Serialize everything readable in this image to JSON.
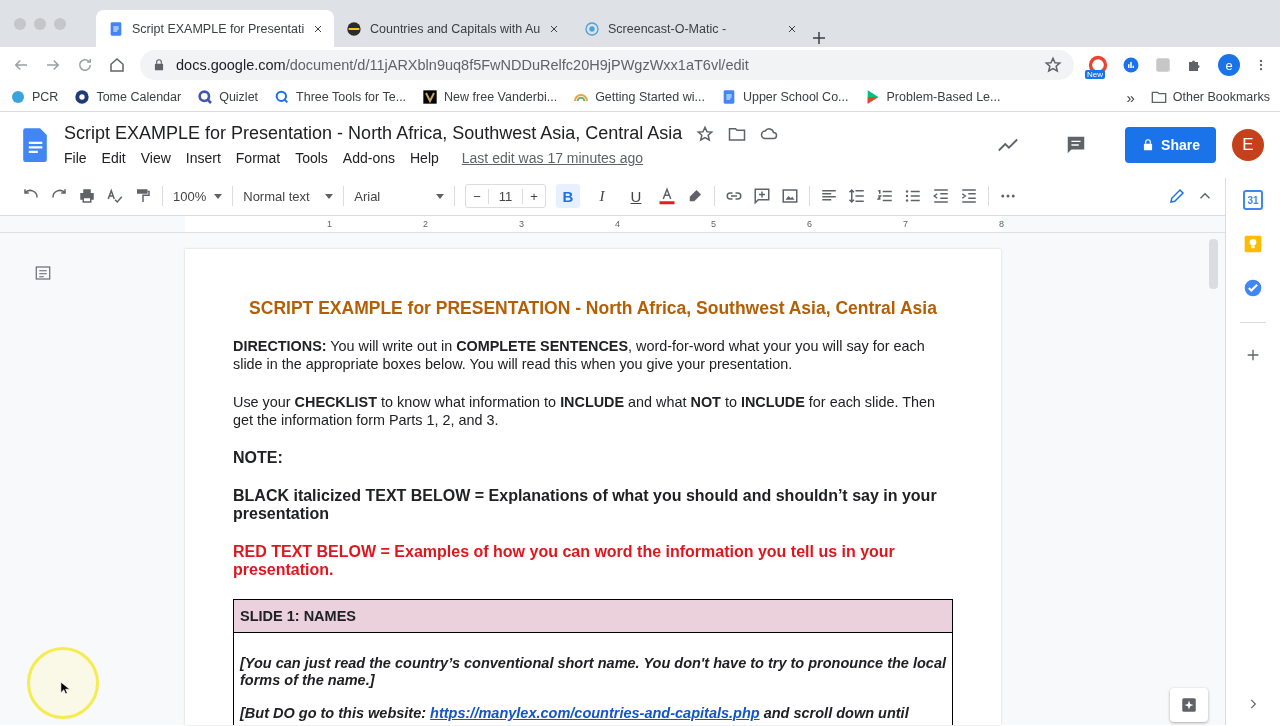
{
  "browser": {
    "tabs": [
      {
        "title": "Script EXAMPLE for Presentati",
        "selected": true,
        "kind": "docs"
      },
      {
        "title": "Countries and Capitals with Au",
        "selected": false,
        "kind": "globe"
      },
      {
        "title": "Screencast-O-Matic -",
        "selected": false,
        "kind": "record"
      }
    ],
    "url": {
      "domain": "docs.google.com",
      "path": "/document/d/11jARXbln9uq8f5FwNDDuRelfc20H9jPWgzWxx1aT6vl/edit"
    },
    "extension_badge": "New",
    "profile": "e",
    "bookmarks": [
      {
        "label": "PCR",
        "kind": "pcr"
      },
      {
        "label": "Tome Calendar",
        "kind": "st"
      },
      {
        "label": "Quizlet",
        "kind": "q"
      },
      {
        "label": "Three Tools for Te...",
        "kind": "search"
      },
      {
        "label": "New free Vanderbi...",
        "kind": "v"
      },
      {
        "label": "Getting Started wi...",
        "kind": "rainbow"
      },
      {
        "label": "Upper School Co...",
        "kind": "docs"
      },
      {
        "label": "Problem-Based Le...",
        "kind": "play"
      }
    ],
    "bookmarks_overflow": "»",
    "other_bookmarks": "Other Bookmarks"
  },
  "docs": {
    "title": "Script EXAMPLE for Presentation - North Africa, Southwest Asia, Central Asia",
    "menu": [
      "File",
      "Edit",
      "View",
      "Insert",
      "Format",
      "Tools",
      "Add-ons",
      "Help"
    ],
    "last_edit": "Last edit was 17 minutes ago",
    "share": "Share",
    "avatar": "E"
  },
  "toolbar": {
    "zoom": "100%",
    "style": "Normal text",
    "font": "Arial",
    "minus": "−",
    "size": "11",
    "plus": "+",
    "bold_label": "B",
    "italic_label": "I",
    "underline_label": "U",
    "bold": true,
    "italic": false,
    "underline": false
  },
  "ruler": [
    "1",
    "2",
    "3",
    "4",
    "5",
    "6",
    "7",
    "8"
  ],
  "side_panel": {
    "calendar_day": "31"
  },
  "document": {
    "heading": "SCRIPT EXAMPLE for PRESENTATION - North Africa, Southwest Asia, Central Asia",
    "paragraphs": [
      {
        "kind": "normal",
        "text": "**DIRECTIONS:** You will write out in **COMPLETE SENTENCES**, word-for-word what your you will say for each slide in the appropriate boxes below. You will read this when you give your presentation."
      },
      {
        "kind": "normal",
        "text": "Use your **CHECKLIST** to know what information to **INCLUDE** and what **NOT** to **INCLUDE** for each slide. Then get the information form Parts 1, 2, and 3."
      },
      {
        "kind": "bold",
        "text": "NOTE:"
      },
      {
        "kind": "bold",
        "text": "BLACK italicized TEXT BELOW = Explanations of what you should and shouldn’t say in your presentation"
      },
      {
        "kind": "red",
        "text": "RED TEXT BELOW = Examples of how you can word the information you tell us in your presentation."
      }
    ],
    "table": {
      "header": "SLIDE 1: NAMES",
      "lines": [
        {
          "text": "[You can just read the country’s conventional short name. You don't have to try to pronounce the local forms of the name.]"
        },
        {
          "text": "[But DO go to this website: ",
          "link": "https://manylex.com/countries-and-capitals.php",
          "after": " and scroll down until"
        }
      ]
    }
  }
}
